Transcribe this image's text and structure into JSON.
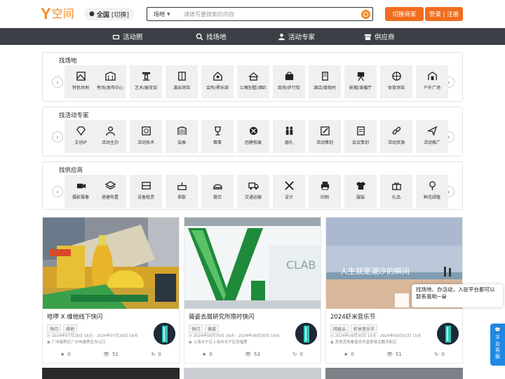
{
  "header": {
    "logo_mark": "Y",
    "logo_text": "空间",
    "city_name": "全国",
    "city_switch": "[切换]",
    "search_type": "场地",
    "search_placeholder": "请填写要搜索的内容",
    "switch_merchant": "切换商家",
    "login_register": "登录 | 注册"
  },
  "nav": {
    "items": [
      "活动照",
      "找场地",
      "活动专家",
      "供应商"
    ]
  },
  "venue_panel": {
    "title": "找场地",
    "items": [
      "特色场地",
      "秀场/发布中心",
      "艺术/展览馆",
      "演出场馆",
      "会所/俱乐部",
      "公寓别墅/酒趴",
      "商场/步行街",
      "酒店/度假村",
      "影棚/演播厅",
      "体育场馆",
      "户外广场"
    ]
  },
  "expert_panel": {
    "title": "找活动专家",
    "items": [
      "文创IP",
      "活动主办",
      "活动技术",
      "会展",
      "赛事",
      "团建拓展",
      "婚礼",
      "活动策划",
      "会议策划",
      "活动资源",
      "活动推广"
    ]
  },
  "supplier_panel": {
    "title": "找供应商",
    "items": [
      "摄影摄像",
      "搭建布置",
      "设备租赁",
      "茶歇",
      "餐饮",
      "交通运输",
      "设计",
      "印刷",
      "服装",
      "礼品",
      "鲜花绿植"
    ]
  },
  "cards": [
    {
      "title": "哈啰 X 维他线下快闪",
      "tags": [
        "快闪",
        "维他"
      ],
      "time": "2024年07月29日 16点 - 2024年07月29日 16点",
      "address": "广州越秀区广州市越秀区东山口",
      "likes": "0",
      "views": "51",
      "shares": "0"
    },
    {
      "title": "薇姿去屑研究所限时快闪",
      "tags": [
        "快闪",
        "薇姿"
      ],
      "time": "2024年08月30日 16点 - 2024年08月30日 16点",
      "address": "上海长宁区上海市长宁区幸福里",
      "likes": "0",
      "views": "53",
      "shares": "0"
    },
    {
      "title": "2024虾米音乐节",
      "tags": [
        "网易云",
        "虾米音乐节"
      ],
      "time": "2024年08月30日 15点 - 2024年09月01日 15点",
      "address": "其他其他秦皇岛市昌黎县北戴河新区",
      "likes": "0",
      "views": "51",
      "shares": "0"
    }
  ],
  "card3_sign": "人生就是潮汐的瞬间",
  "card2_sign": "CLAB",
  "chat_popup": "找场地、办活动，入驻平台都可以联系我哟~😀",
  "service_button": "平台客服",
  "colors": {
    "accent": "#f06d1f",
    "nav_bg": "#3c3f45",
    "service_blue": "#1e88e5"
  }
}
